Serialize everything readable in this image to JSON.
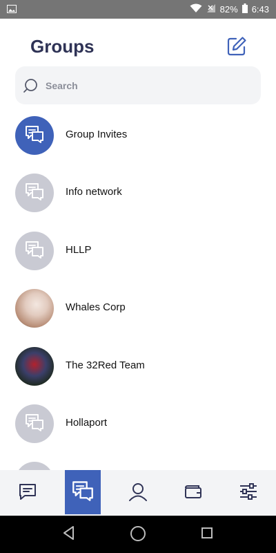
{
  "status_bar": {
    "battery": "82%",
    "time": "6:43"
  },
  "header": {
    "title": "Groups"
  },
  "search": {
    "placeholder": "Search"
  },
  "groups": [
    {
      "name": "Group Invites",
      "avatar": "chat-group-icon",
      "style": "active"
    },
    {
      "name": "Info network",
      "avatar": "chat-group-icon",
      "style": "grey"
    },
    {
      "name": "HLLP",
      "avatar": "chat-group-icon",
      "style": "grey"
    },
    {
      "name": "Whales Corp",
      "avatar": "photo",
      "style": "photo"
    },
    {
      "name": "The 32Red Team",
      "avatar": "photo",
      "style": "photo"
    },
    {
      "name": "Hollaport",
      "avatar": "chat-group-icon",
      "style": "grey"
    }
  ],
  "bottom_nav": [
    {
      "name": "messages",
      "icon": "chat-icon",
      "active": false
    },
    {
      "name": "groups",
      "icon": "chat-group-icon",
      "active": true
    },
    {
      "name": "profile",
      "icon": "person-icon",
      "active": false
    },
    {
      "name": "wallet",
      "icon": "wallet-icon",
      "active": false
    },
    {
      "name": "settings",
      "icon": "sliders-icon",
      "active": false
    }
  ],
  "colors": {
    "accent": "#3f62b9",
    "title": "#2f3356",
    "grey_avatar": "#c9cad3"
  }
}
